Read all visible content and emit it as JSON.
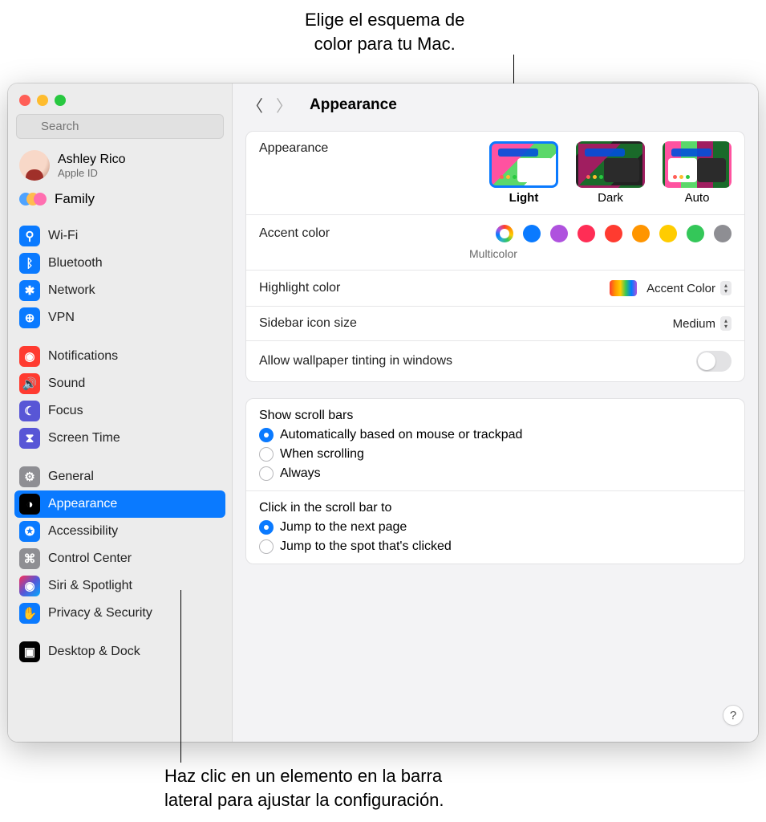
{
  "callouts": {
    "top_line1": "Elige el esquema de",
    "top_line2": "color para tu Mac.",
    "bottom_line1": "Haz clic en un elemento en la barra",
    "bottom_line2": "lateral para ajustar la configuración."
  },
  "search": {
    "placeholder": "Search"
  },
  "account": {
    "name": "Ashley Rico",
    "sub": "Apple ID"
  },
  "family_label": "Family",
  "sidebar": {
    "wifi": "Wi-Fi",
    "bluetooth": "Bluetooth",
    "network": "Network",
    "vpn": "VPN",
    "notifications": "Notifications",
    "sound": "Sound",
    "focus": "Focus",
    "screentime": "Screen Time",
    "general": "General",
    "appearance": "Appearance",
    "accessibility": "Accessibility",
    "controlcenter": "Control Center",
    "siri": "Siri & Spotlight",
    "privacy": "Privacy & Security",
    "desktop": "Desktop & Dock"
  },
  "header": {
    "title": "Appearance"
  },
  "appearance": {
    "label": "Appearance",
    "light": "Light",
    "dark": "Dark",
    "auto": "Auto",
    "selected": "Light"
  },
  "accent": {
    "label": "Accent color",
    "selected_name": "Multicolor",
    "colors": [
      "multicolor",
      "#0a7aff",
      "#af52de",
      "#ff2d55",
      "#ff3b30",
      "#ff9500",
      "#ffcc00",
      "#34c759",
      "#8e8e93"
    ]
  },
  "highlight": {
    "label": "Highlight color",
    "value": "Accent Color"
  },
  "sidebar_icon": {
    "label": "Sidebar icon size",
    "value": "Medium"
  },
  "wallpaper_tint": {
    "label": "Allow wallpaper tinting in windows",
    "on": false
  },
  "scrollbars": {
    "title": "Show scroll bars",
    "opt1": "Automatically based on mouse or trackpad",
    "opt2": "When scrolling",
    "opt3": "Always",
    "selected": 0
  },
  "scrollclick": {
    "title": "Click in the scroll bar to",
    "opt1": "Jump to the next page",
    "opt2": "Jump to the spot that's clicked",
    "selected": 0
  },
  "help": "?"
}
